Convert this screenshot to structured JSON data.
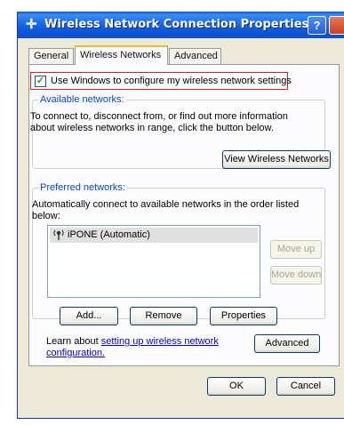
{
  "window": {
    "title": "Wireless Network Connection Properties",
    "help_label": "?",
    "accent_color": "#0b4fc9"
  },
  "tabs": [
    {
      "label": "General"
    },
    {
      "label": "Wireless Networks"
    },
    {
      "label": "Advanced"
    }
  ],
  "use_windows": {
    "label": "Use Windows to configure my wireless network settings",
    "checked": true
  },
  "available": {
    "title": "Available networks:",
    "description": "To connect to, disconnect from, or find out more information about wireless networks in range, click the button below.",
    "view_button": "View Wireless Networks"
  },
  "preferred": {
    "title": "Preferred networks:",
    "description": "Automatically connect to available networks in the order listed below:",
    "items": [
      {
        "label": "iPONE (Automatic)",
        "icon": "wireless-antenna-icon"
      }
    ],
    "move_up": "Move up",
    "move_down": "Move down",
    "add": "Add...",
    "remove": "Remove",
    "properties": "Properties"
  },
  "learn": {
    "prefix": "Learn about ",
    "link": "setting up wireless network configuration.",
    "advanced_button": "Advanced"
  },
  "footer": {
    "ok": "OK",
    "cancel": "Cancel"
  }
}
